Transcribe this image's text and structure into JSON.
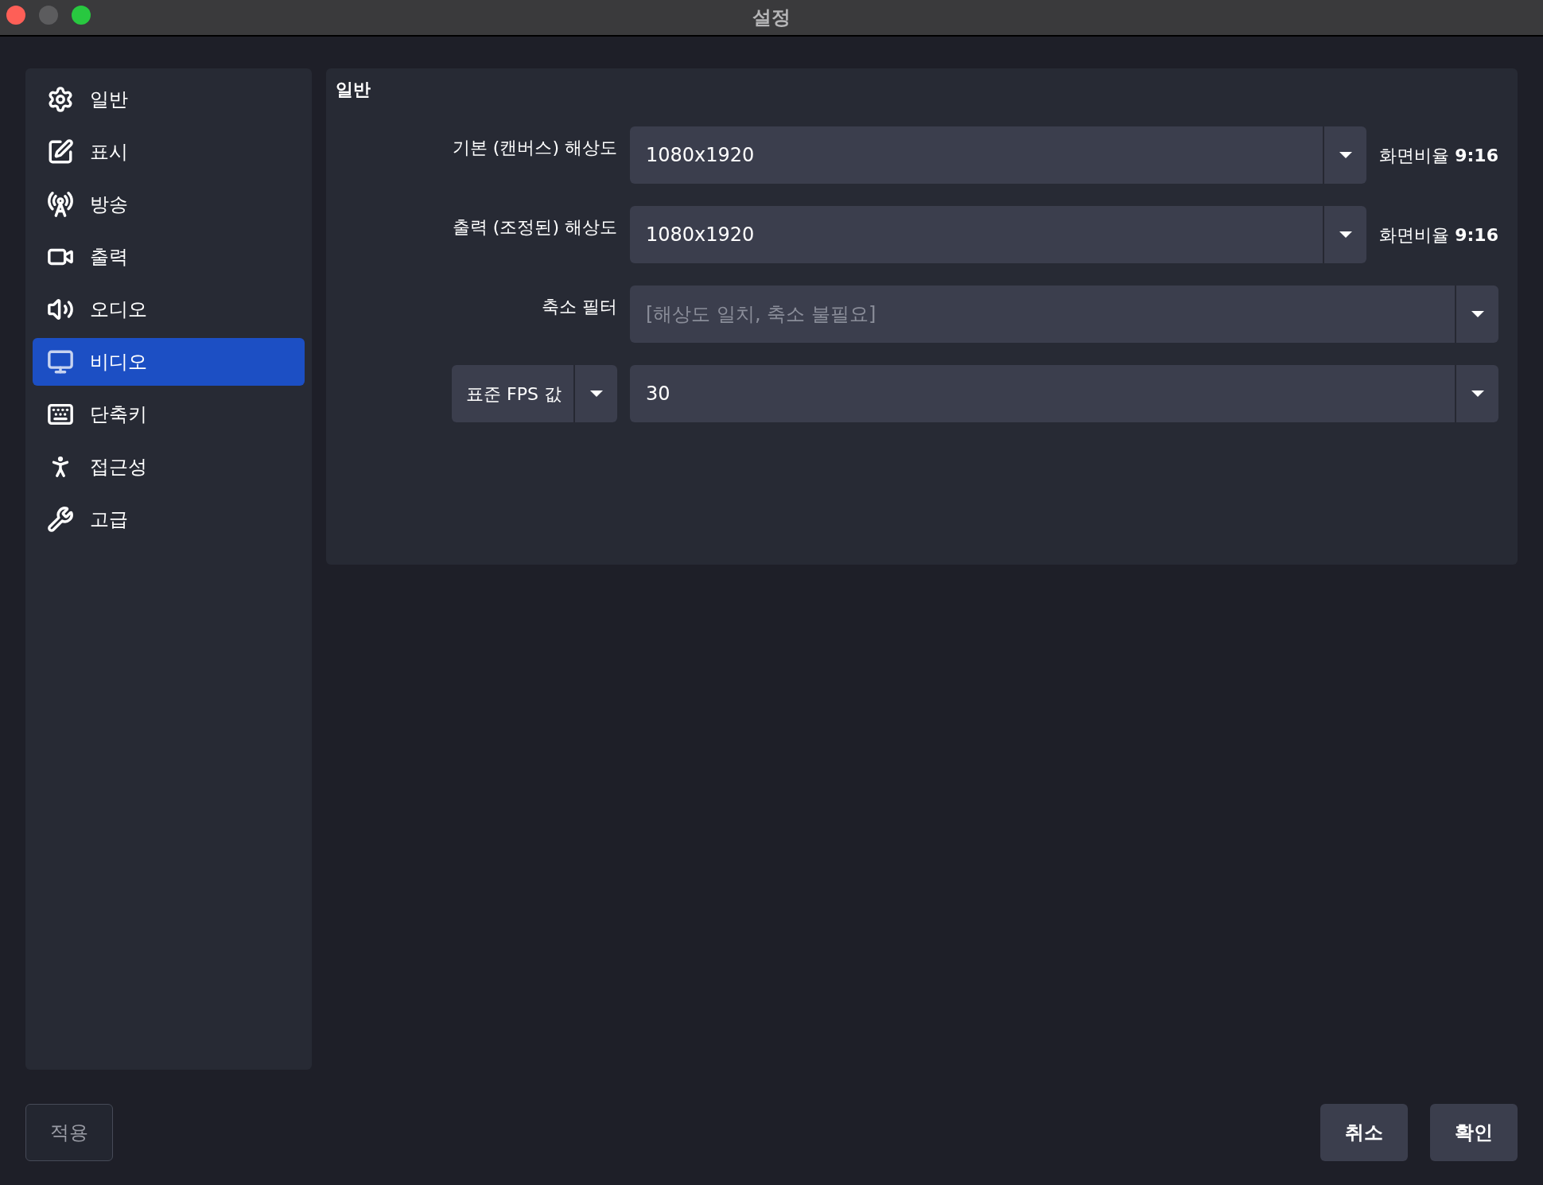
{
  "window": {
    "title": "설정"
  },
  "sidebar": {
    "items": [
      {
        "label": "일반",
        "selected": false
      },
      {
        "label": "표시",
        "selected": false
      },
      {
        "label": "방송",
        "selected": false
      },
      {
        "label": "출력",
        "selected": false
      },
      {
        "label": "오디오",
        "selected": false
      },
      {
        "label": "비디오",
        "selected": true
      },
      {
        "label": "단축키",
        "selected": false
      },
      {
        "label": "접근성",
        "selected": false
      },
      {
        "label": "고급",
        "selected": false
      }
    ]
  },
  "section": {
    "title": "일반",
    "rows": [
      {
        "kind": "combo",
        "label": "기본 (캔버스) 해상도",
        "value": "1080x1920",
        "ratio": "화면비율 **9:16**"
      },
      {
        "kind": "combo",
        "label": "출력 (조정된) 해상도",
        "value": "1080x1920",
        "ratio": "화면비율 **9:16**"
      },
      {
        "kind": "select",
        "label": "축소 필터",
        "placeholder": "[해상도 일치, 축소 불필요]",
        "disabled": true
      },
      {
        "kind": "fps",
        "label": "표준 FPS 값",
        "value": "30"
      }
    ]
  },
  "buttons": [
    {
      "label": "적용",
      "disabled": true
    },
    {
      "label": "취소",
      "disabled": false
    },
    {
      "label": "확인",
      "disabled": false
    }
  ]
}
